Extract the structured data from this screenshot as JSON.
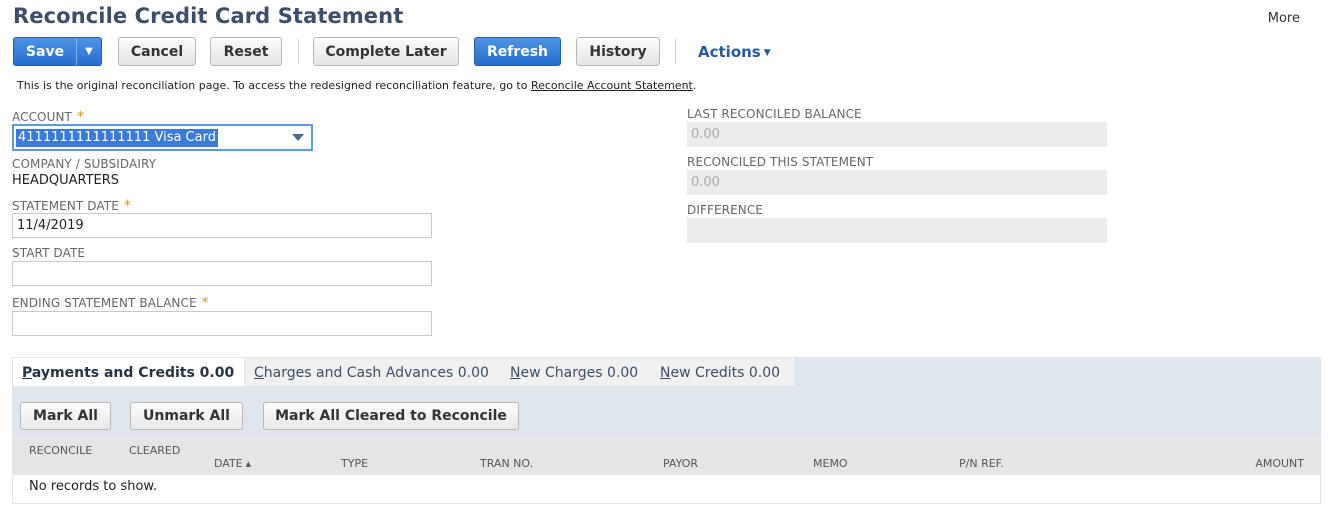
{
  "header": {
    "title": "Reconcile Credit Card Statement",
    "more_label": "More"
  },
  "toolbar": {
    "save_label": "Save",
    "save_dropdown_icon": "▼",
    "cancel_label": "Cancel",
    "reset_label": "Reset",
    "complete_later_label": "Complete Later",
    "refresh_label": "Refresh",
    "history_label": "History",
    "actions_label": "Actions",
    "actions_caret": "▼"
  },
  "notice": {
    "text": "This is the original reconciliation page. To access the redesigned reconciliation feature, go to",
    "link": "Reconcile Account Statement",
    "suffix": "."
  },
  "form": {
    "account_label": "ACCOUNT",
    "account_value": "4111111111111111 Visa Card",
    "required_mark": "*",
    "company_label": "COMPANY / SUBSIDAIRY",
    "company_value": "HEADQUARTERS",
    "statement_date_label": "STATEMENT DATE",
    "statement_date_value": "11/4/2019",
    "start_date_label": "START DATE",
    "start_date_value": "",
    "ending_balance_label": "ENDING STATEMENT BALANCE",
    "ending_balance_value": "",
    "last_reconciled_label": "LAST RECONCILED BALANCE",
    "last_reconciled_value": "0.00",
    "reconciled_this_label": "RECONCILED THIS STATEMENT",
    "reconciled_this_value": "0.00",
    "difference_label": "DIFFERENCE",
    "difference_value": ""
  },
  "tabs": [
    {
      "label_u": "P",
      "label_rest": "ayments and Credits 0.00",
      "active": true
    },
    {
      "label_u": "C",
      "label_rest": "harges and Cash Advances 0.00",
      "active": false
    },
    {
      "label_u": "N",
      "label_rest": "ew Charges 0.00",
      "active": false
    },
    {
      "label_u": "N",
      "label_rest": "ew Credits 0.00",
      "active": false
    }
  ],
  "sublist": {
    "mark_all_label": "Mark All",
    "unmark_all_label": "Unmark All",
    "mark_cleared_label": "Mark All Cleared to Reconcile",
    "columns": {
      "reconcile": "RECONCILE",
      "cleared": "CLEARED",
      "date": "DATE",
      "date_sort_icon": "▲",
      "type": "TYPE",
      "tran_no": "TRAN NO.",
      "payor": "PAYOR",
      "memo": "MEMO",
      "pn_ref": "P/N REF.",
      "amount": "AMOUNT"
    },
    "empty_text": "No records to show."
  },
  "colors": {
    "primary": "#2a6ccd",
    "title": "#3d4e66",
    "required": "#e8901b",
    "tab_bg": "#dfe5ec"
  }
}
